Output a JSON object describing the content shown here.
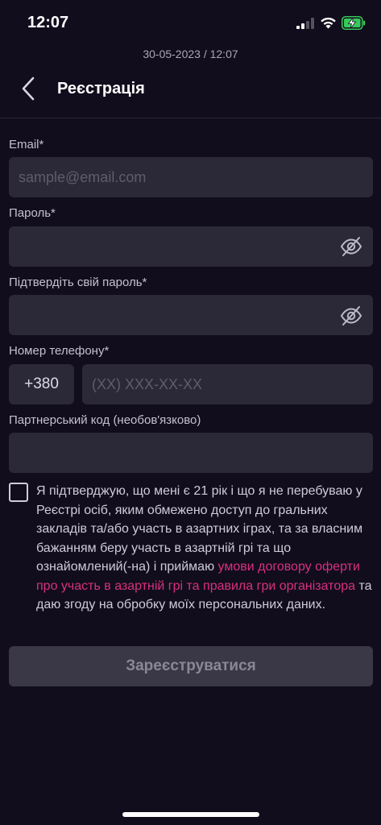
{
  "status_bar": {
    "time": "12:07",
    "icons": [
      "signal-icon",
      "wifi-icon",
      "battery-charging-icon"
    ]
  },
  "datetime": "30-05-2023 / 12:07",
  "header": {
    "title": "Реєстрація",
    "back_icon": "chevron-left-icon"
  },
  "form": {
    "email": {
      "label": "Email*",
      "value": "",
      "placeholder": "sample@email.com"
    },
    "password": {
      "label": "Пароль*",
      "value": "",
      "toggle_icon": "eye-off-icon"
    },
    "confirm_password": {
      "label": "Підтвердіть свій пароль*",
      "value": "",
      "toggle_icon": "eye-off-icon"
    },
    "phone": {
      "label": "Номер телефону*",
      "country_code": "+380",
      "value": "",
      "placeholder": "(XX) XXX-XX-XX"
    },
    "partner_code": {
      "label": "Партнерський код (необов'язково)",
      "value": ""
    }
  },
  "consent": {
    "checked": false,
    "text_before": "Я підтверджую, що мені є 21 рік і що я не перебуваю у Реєстрі осіб, яким обмежено доступ до гральних закладів та/або участь в азартних іграх, та за власним бажанням беру участь в азартній грі та що ознайомлений(-на) і приймаю ",
    "link_text": "умови договору оферти про участь в азартній грі та правила гри організатора",
    "text_after": " та даю згоду на обробку моїх персональних даних."
  },
  "submit_label": "Зареєструватися",
  "colors": {
    "background": "#110d1d",
    "field": "#2b2838",
    "accent_link": "#d9307f",
    "button_disabled": "#3a3746"
  }
}
